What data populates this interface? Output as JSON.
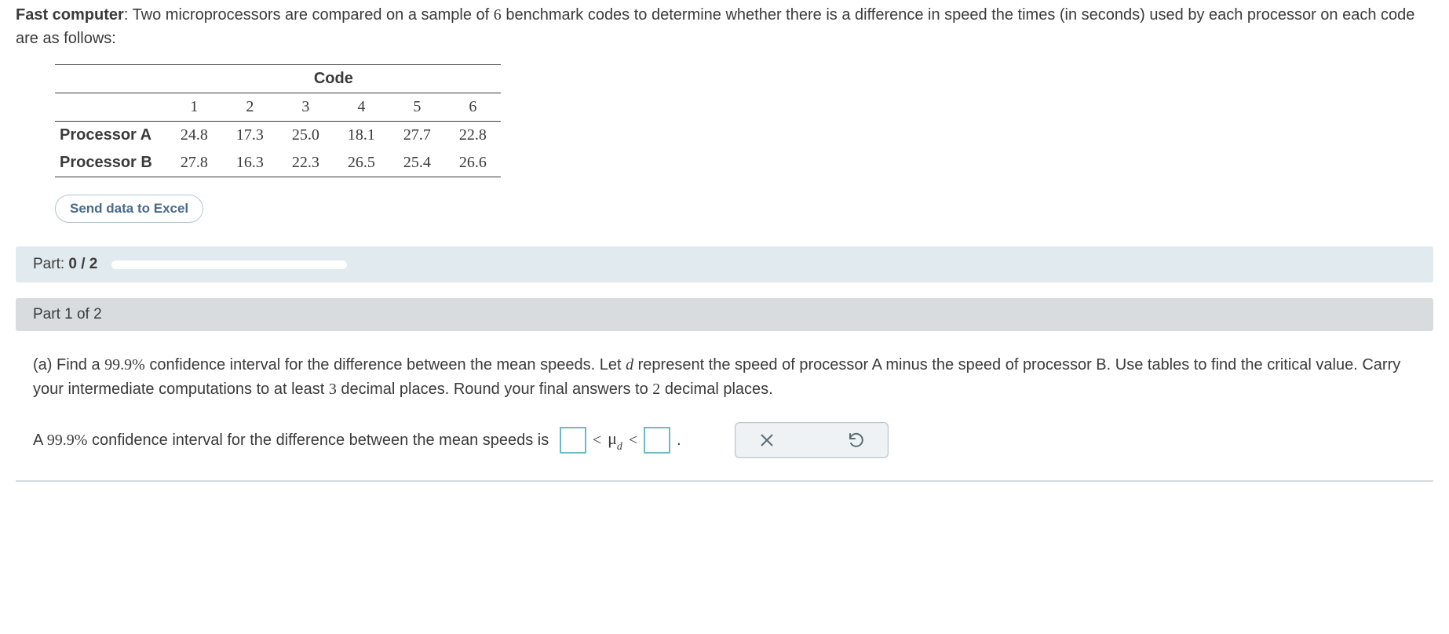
{
  "intro": {
    "bold_label": "Fast computer",
    "text_after_bold": ": Two microprocessors are compared on a sample of ",
    "sample_n": "6",
    "text_after_n": " benchmark codes to determine whether there is a difference in speed the times (in seconds) used by each processor on each code are as follows:"
  },
  "table": {
    "header": "Code",
    "cols": [
      "1",
      "2",
      "3",
      "4",
      "5",
      "6"
    ],
    "rows": [
      {
        "label": "Processor A",
        "vals": [
          "24.8",
          "17.3",
          "25.0",
          "18.1",
          "27.7",
          "22.8"
        ]
      },
      {
        "label": "Processor B",
        "vals": [
          "27.8",
          "16.3",
          "22.3",
          "26.5",
          "25.4",
          "26.6"
        ]
      }
    ]
  },
  "send_button": "Send data to Excel",
  "progress": {
    "prefix": "Part: ",
    "value": "0 / 2"
  },
  "part_header": "Part 1 of 2",
  "question": {
    "p1": "(a) Find a ",
    "conf": "99.9%",
    "p2": " confidence interval for the difference between the mean speeds. Let ",
    "var": "d",
    "p3": " represent the speed of processor A minus the speed of processor B. Use tables to find the critical value. Carry your intermediate computations to at least ",
    "dec1": "3",
    "p4": " decimal places. Round your final answers to ",
    "dec2": "2",
    "p5": " decimal places."
  },
  "answer": {
    "p1": "A ",
    "conf": "99.9%",
    "p2": " confidence interval for the difference between the mean speeds is ",
    "lt1": "<",
    "mu": "μ",
    "sub": "d",
    "lt2": "<",
    "period": "."
  },
  "icons": {
    "close": "close-icon",
    "undo": "undo-icon"
  }
}
